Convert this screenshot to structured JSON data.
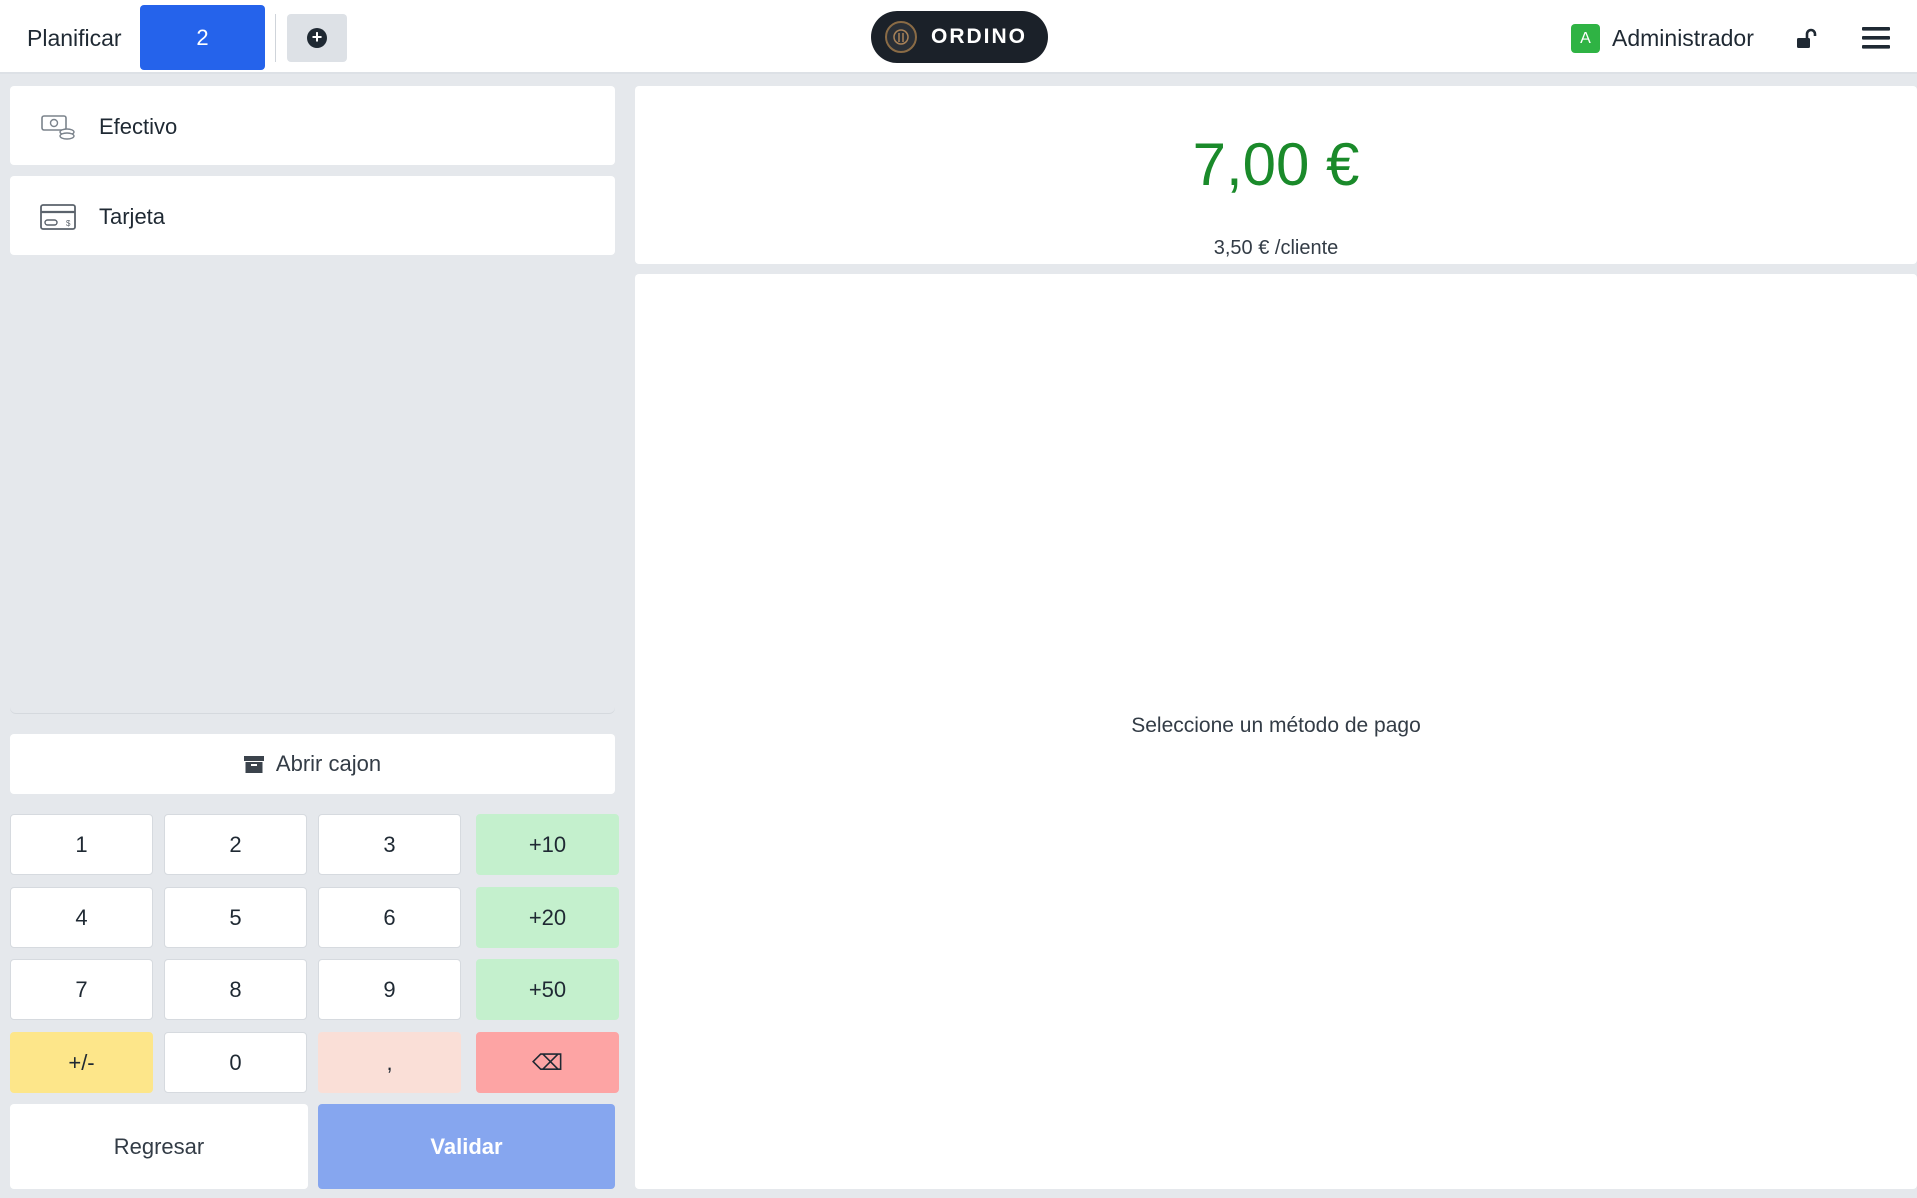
{
  "header": {
    "plan_label": "Planificar",
    "order_tab": "2",
    "logo_text": "ORDINO",
    "user": {
      "initial": "A",
      "name": "Administrador"
    }
  },
  "payment_methods": [
    {
      "label": "Efectivo",
      "icon": "cash-icon"
    },
    {
      "label": "Tarjeta",
      "icon": "card-icon"
    }
  ],
  "drawer": {
    "label": "Abrir cajon"
  },
  "numpad": {
    "keys": [
      "1",
      "2",
      "3",
      "+10",
      "4",
      "5",
      "6",
      "+20",
      "7",
      "8",
      "9",
      "+50",
      "+/-",
      "0",
      ",",
      "⌫"
    ]
  },
  "actions": {
    "back": "Regresar",
    "validate": "Validar"
  },
  "summary": {
    "total": "7,00 €",
    "per_client": "3,50 € /cliente"
  },
  "main": {
    "hint": "Seleccione un método de pago"
  },
  "colors": {
    "accent": "#2563eb",
    "total": "#1a8a2a",
    "validate": "#86a6ef",
    "green_key": "#c4f0cd",
    "yellow_key": "#fde68a",
    "pink_key": "#fadfd7",
    "red_key": "#fda4a4"
  }
}
